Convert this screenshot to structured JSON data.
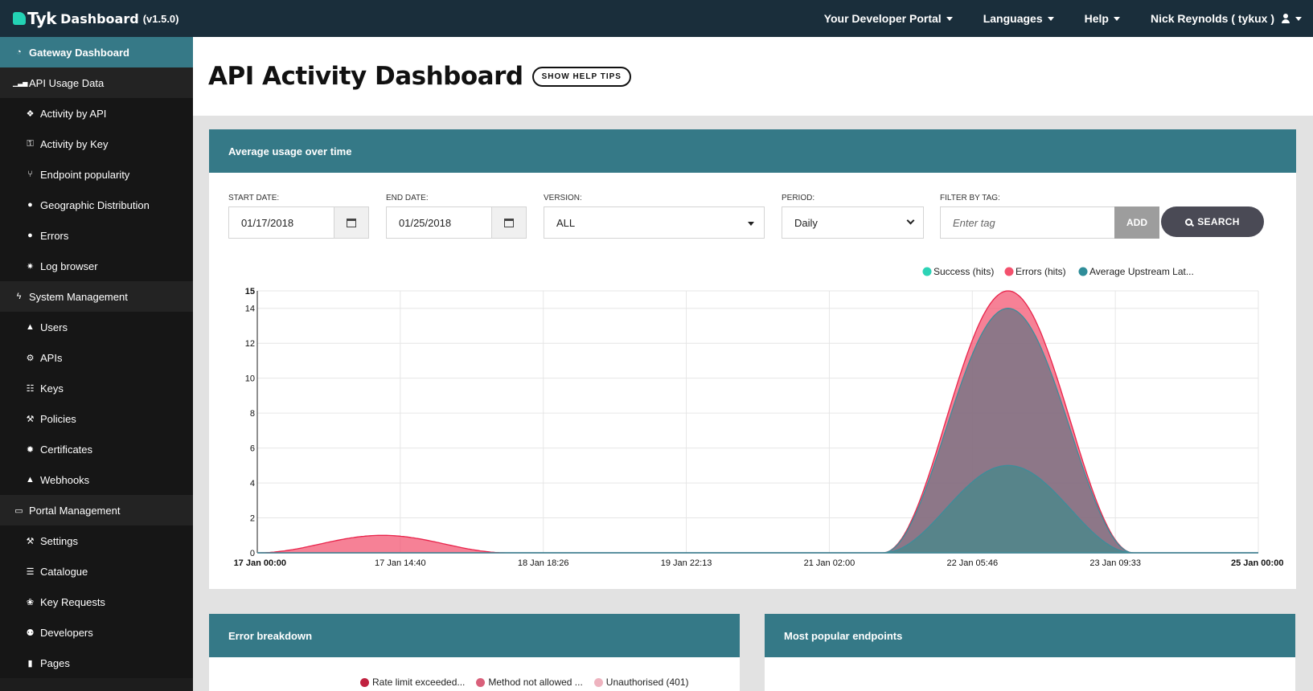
{
  "brand": {
    "name": "Tyk",
    "product": "Dashboard",
    "version": "(v1.5.0)"
  },
  "topnav": {
    "portal": "Your Developer Portal",
    "languages": "Languages",
    "help": "Help",
    "user": "Nick Reynolds ( tykux )"
  },
  "sidebar": {
    "items": [
      {
        "label": "Gateway Dashboard",
        "icon": "dashboard-icon",
        "type": "active"
      },
      {
        "label": "API Usage Data",
        "icon": "bar-chart-icon",
        "type": "section"
      },
      {
        "label": "Activity by API",
        "icon": "cubes-icon",
        "type": "sub"
      },
      {
        "label": "Activity by Key",
        "icon": "key-icon",
        "type": "sub"
      },
      {
        "label": "Endpoint popularity",
        "icon": "code-fork-icon",
        "type": "sub"
      },
      {
        "label": "Geographic Distribution",
        "icon": "globe-icon",
        "type": "sub"
      },
      {
        "label": "Errors",
        "icon": "bomb-icon",
        "type": "sub"
      },
      {
        "label": "Log browser",
        "icon": "bug-icon",
        "type": "sub"
      },
      {
        "label": "System Management",
        "icon": "bolt-icon",
        "type": "section"
      },
      {
        "label": "Users",
        "icon": "user-icon",
        "type": "sub"
      },
      {
        "label": "APIs",
        "icon": "cogs-icon",
        "type": "sub"
      },
      {
        "label": "Keys",
        "icon": "sitemap-icon",
        "type": "sub"
      },
      {
        "label": "Policies",
        "icon": "gavel-icon",
        "type": "sub"
      },
      {
        "label": "Certificates",
        "icon": "certificate-icon",
        "type": "sub"
      },
      {
        "label": "Webhooks",
        "icon": "bell-icon",
        "type": "sub"
      },
      {
        "label": "Portal Management",
        "icon": "folder-open-icon",
        "type": "section"
      },
      {
        "label": "Settings",
        "icon": "wrench-icon",
        "type": "sub"
      },
      {
        "label": "Catalogue",
        "icon": "list-icon",
        "type": "sub"
      },
      {
        "label": "Key Requests",
        "icon": "paw-icon",
        "type": "sub"
      },
      {
        "label": "Developers",
        "icon": "users-icon",
        "type": "sub"
      },
      {
        "label": "Pages",
        "icon": "book-icon",
        "type": "sub"
      }
    ]
  },
  "page": {
    "title": "API Activity Dashboard",
    "help_button": "SHOW HELP TIPS"
  },
  "usage_panel": {
    "title": "Average usage over time",
    "filters": {
      "start_label": "START DATE:",
      "start_value": "01/17/2018",
      "end_label": "END DATE:",
      "end_value": "01/25/2018",
      "version_label": "VERSION:",
      "version_value": "ALL",
      "period_label": "PERIOD:",
      "period_value": "Daily",
      "tag_label": "FILTER BY TAG:",
      "tag_placeholder": "Enter tag",
      "add_button": "ADD",
      "search_button": "SEARCH"
    }
  },
  "chart_data": {
    "type": "area",
    "title": "",
    "xlabel": "",
    "ylabel": "",
    "ylim": [
      0,
      15
    ],
    "yticks": [
      0,
      2,
      4,
      6,
      8,
      10,
      12,
      14,
      15
    ],
    "xticks": [
      "17 Jan 00:00",
      "17 Jan 14:40",
      "18 Jan 18:26",
      "19 Jan 22:13",
      "21 Jan 02:00",
      "22 Jan 05:46",
      "23 Jan 09:33",
      "25 Jan 00:00"
    ],
    "legend_position": "top-right",
    "grid": true,
    "x": [
      "17 Jan",
      "18 Jan",
      "19 Jan",
      "20 Jan",
      "21 Jan",
      "22 Jan",
      "23 Jan",
      "24 Jan",
      "25 Jan"
    ],
    "series": [
      {
        "name": "Success (hits)",
        "color": "#2dd3b6",
        "values": [
          0,
          0,
          0,
          0,
          0,
          0,
          14,
          0,
          0
        ]
      },
      {
        "name": "Errors (hits)",
        "color": "#f3516d",
        "values": [
          0,
          1,
          0,
          0,
          0,
          0,
          15,
          0,
          0
        ]
      },
      {
        "name": "Average Upstream Lat...",
        "color": "#2f8d99",
        "values": [
          0,
          0,
          0,
          0,
          0,
          0,
          5,
          0,
          0
        ]
      }
    ]
  },
  "error_panel": {
    "title": "Error breakdown",
    "legend": [
      {
        "name": "Rate limit exceeded...",
        "color": "#c0213f"
      },
      {
        "name": "Method not allowed ...",
        "color": "#d9607a"
      },
      {
        "name": "Unauthorised (401)",
        "color": "#eeb3bf"
      }
    ]
  },
  "endpoints_panel": {
    "title": "Most popular endpoints"
  }
}
